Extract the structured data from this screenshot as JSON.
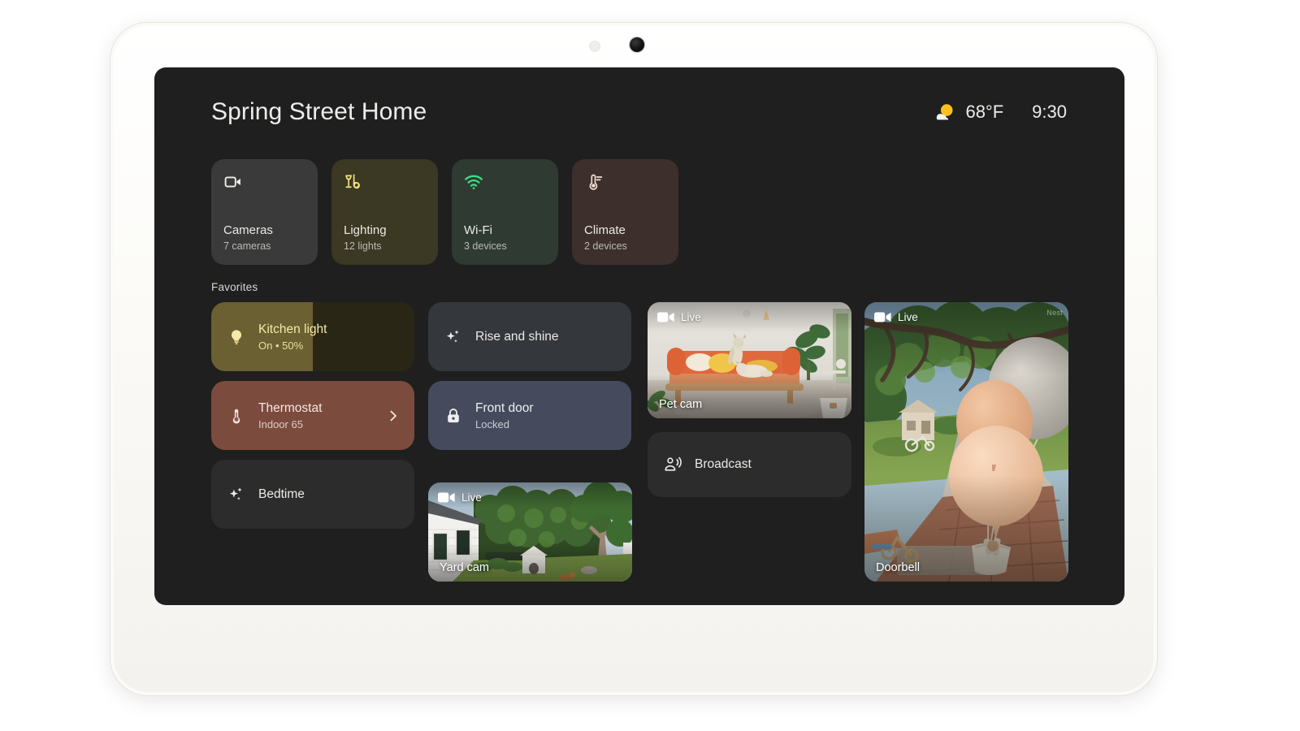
{
  "device": {
    "name": "google-nest-hub-tablet",
    "bezel_color": "#fbfaf7",
    "screen_bg": "#1f1f1f"
  },
  "header": {
    "home_title": "Spring Street Home",
    "weather": {
      "icon": "sun-behind-cloud-icon",
      "temperature": "68°F",
      "sun_color": "#fcc11b",
      "cloud_color": "#f1f0ec"
    },
    "clock": "9:30"
  },
  "categories": [
    {
      "id": "cameras",
      "icon": "video-camera-icon",
      "label": "Cameras",
      "sub": "7 cameras",
      "bg": "#3a3a3a",
      "icon_color": "#f1efeb"
    },
    {
      "id": "lighting",
      "icon": "lamps-icon",
      "label": "Lighting",
      "sub": "12 lights",
      "bg": "#3b3823",
      "icon_color": "#f2e27a"
    },
    {
      "id": "wifi",
      "icon": "wifi-icon",
      "label": "Wi-Fi",
      "sub": "3 devices",
      "bg": "#2f3a33",
      "icon_color": "#3ddc84"
    },
    {
      "id": "climate",
      "icon": "thermometer-icon",
      "label": "Climate",
      "sub": "2 devices",
      "bg": "#3c2f2c",
      "icon_color": "#f4ded6"
    }
  ],
  "favorites": {
    "section_label": "Favorites",
    "kitchen_light": {
      "icon": "lightbulb-icon",
      "title": "Kitchen light",
      "subtitle": "On • 50%",
      "brightness_percent": 50,
      "fill_color": "#6a6032",
      "track_color": "#2a2615",
      "text_color": "#f5e9a8"
    },
    "thermostat": {
      "icon": "thermostat-icon",
      "title": "Thermostat",
      "subtitle": "Indoor 65",
      "chevron": "chevron-right-icon",
      "bg": "#7b4b3d"
    },
    "bedtime": {
      "icon": "sparkles-icon",
      "title": "Bedtime",
      "bg": "#2c2c2c"
    },
    "rise_and_shine": {
      "icon": "sparkles-icon",
      "title": "Rise and shine",
      "bg": "#34373c"
    },
    "front_door": {
      "icon": "lock-closed-icon",
      "title": "Front door",
      "subtitle": "Locked",
      "bg": "#454b5c"
    },
    "broadcast": {
      "icon": "broadcast-person-icon",
      "title": "Broadcast",
      "bg": "#2c2c2c"
    }
  },
  "cameras": [
    {
      "id": "pet-cam",
      "badge_icon": "video-camera-icon",
      "badge_label": "Live",
      "caption": "Pet cam",
      "scene": "two dogs on an orange sofa in a bright living room with plants"
    },
    {
      "id": "yard-cam",
      "badge_icon": "video-camera-icon",
      "badge_label": "Live",
      "caption": "Yard cam",
      "scene": "backyard with white house, hedge, tree, doghouse and lawn"
    },
    {
      "id": "doorbell-cam",
      "badge_icon": "video-camera-icon",
      "badge_label": "Live",
      "caption": "Doorbell",
      "watermark": "Nest",
      "scene": "front garden path with oak tree and pastel balloons"
    }
  ]
}
